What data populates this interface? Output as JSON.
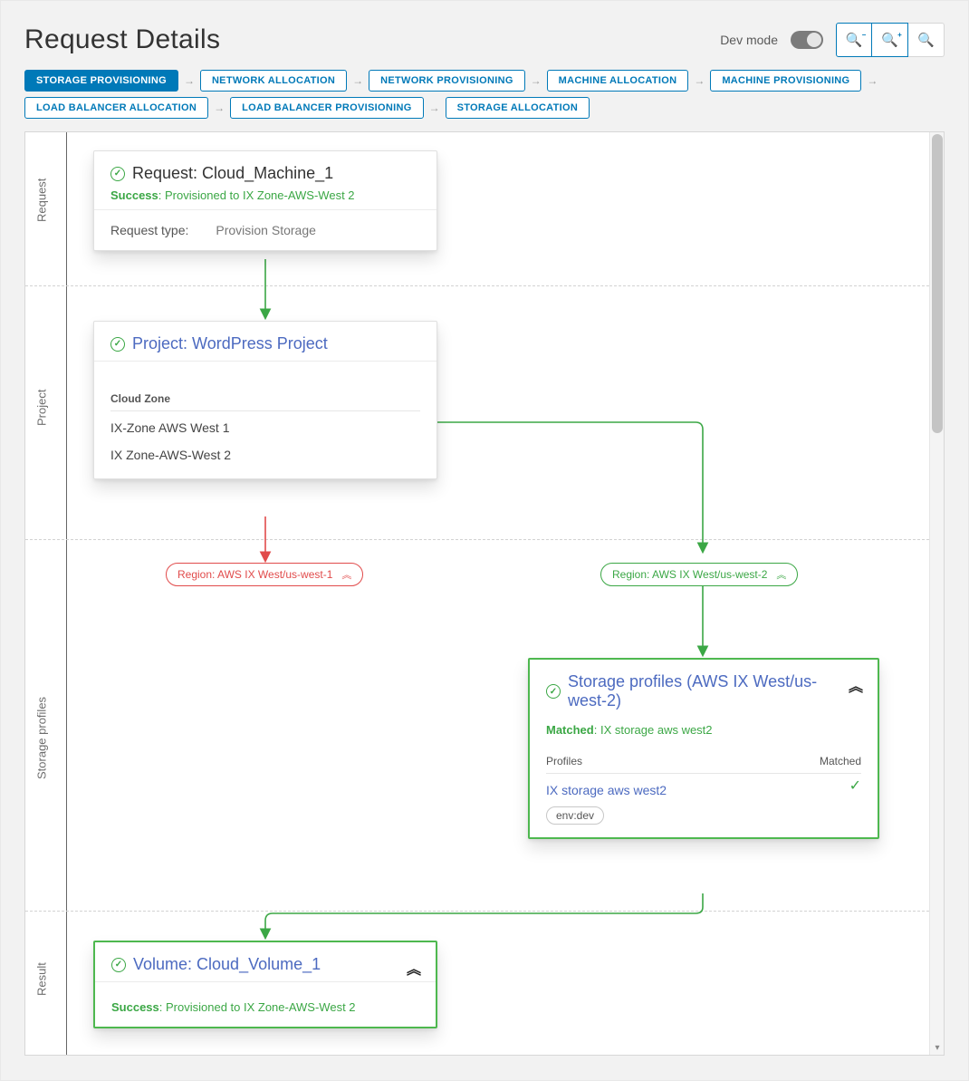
{
  "header": {
    "title": "Request Details",
    "dev_mode_label": "Dev mode"
  },
  "crumbs": [
    {
      "label": "STORAGE PROVISIONING",
      "active": true
    },
    {
      "label": "NETWORK ALLOCATION",
      "active": false
    },
    {
      "label": "NETWORK PROVISIONING",
      "active": false
    },
    {
      "label": "MACHINE ALLOCATION",
      "active": false
    },
    {
      "label": "MACHINE PROVISIONING",
      "active": false
    },
    {
      "label": "LOAD BALANCER ALLOCATION",
      "active": false
    },
    {
      "label": "LOAD BALANCER PROVISIONING",
      "active": false
    },
    {
      "label": "STORAGE ALLOCATION",
      "active": false
    }
  ],
  "rows": {
    "request": {
      "label": "Request"
    },
    "project": {
      "label": "Project"
    },
    "profiles": {
      "label": "Storage profiles"
    },
    "result": {
      "label": "Result"
    }
  },
  "request_card": {
    "title": "Request: Cloud_Machine_1",
    "status_pre": "Success",
    "status_msg": "Provisioned to IX Zone-AWS-West 2",
    "type_label": "Request type:",
    "type_value": "Provision Storage"
  },
  "project_card": {
    "title": "Project: WordPress Project",
    "zone_header": "Cloud Zone",
    "zones": [
      "IX-Zone AWS West 1",
      "IX Zone-AWS-West 2"
    ]
  },
  "regions": {
    "west1": "Region: AWS IX West/us-west-1",
    "west2": "Region: AWS IX West/us-west-2"
  },
  "profiles_card": {
    "title": "Storage profiles (AWS IX West/us-west-2)",
    "matched_pre": "Matched",
    "matched_val": "IX storage aws west2",
    "col_profiles": "Profiles",
    "col_matched": "Matched",
    "profile_name": "IX storage aws west2",
    "tag": "env:dev"
  },
  "result_card": {
    "title": "Volume: Cloud_Volume_1",
    "status_pre": "Success",
    "status_msg": "Provisioned to IX Zone-AWS-West 2"
  }
}
